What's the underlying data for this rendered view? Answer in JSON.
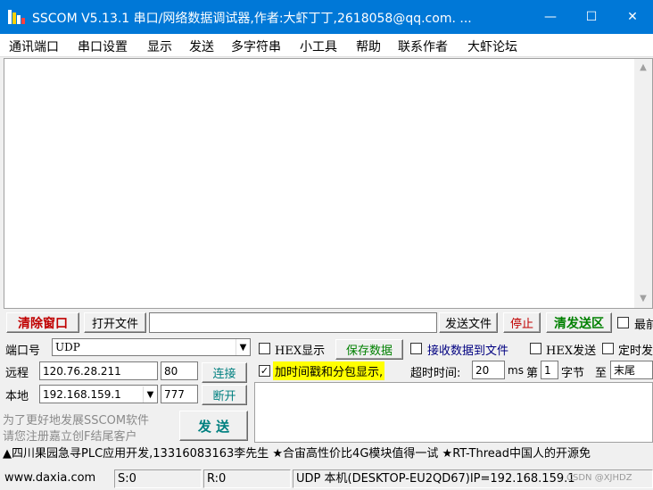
{
  "window": {
    "title": "SSCOM V5.13.1 串口/网络数据调试器,作者:大虾丁丁,2618058@qq.com. ...",
    "minimize": "—",
    "maximize": "☐",
    "close": "✕"
  },
  "menu": [
    "通讯端口",
    "串口设置",
    "显示",
    "发送",
    "多字符串",
    "小工具",
    "帮助",
    "联系作者",
    "大虾论坛"
  ],
  "toolbar": {
    "clear_window": "清除窗口",
    "open_file": "打开文件",
    "file_path": "",
    "send_file": "发送文件",
    "stop": "停止",
    "clear_send": "清发送区",
    "last_label": "最前"
  },
  "port": {
    "label": "端口号",
    "value": "UDP",
    "remote_label": "远程",
    "remote_ip": "120.76.28.211",
    "remote_port": "80",
    "connect": "连接",
    "local_label": "本地",
    "local_ip": "192.168.159.1",
    "local_port": "777",
    "disconnect": "断开"
  },
  "options": {
    "hex_display": "HEX显示",
    "save_data": "保存数据",
    "recv_to_file": "接收数据到文件",
    "hex_send": "HEX发送",
    "timed_send": "定时发",
    "timestamp": "加时间戳和分包显示,",
    "timestamp_checked": "✓",
    "timeout_label": "超时时间:",
    "timeout_value": "20",
    "ms": "ms",
    "di": "第",
    "byte_index": "1",
    "byte_label": "字节",
    "to_label": "至",
    "end_value": "末尾"
  },
  "promo": {
    "line1": "为了更好地发展SSCOM软件",
    "line2": "请您注册嘉立创F结尾客户"
  },
  "send_button": "发 送",
  "ticker": "▲四川果园急寻PLC应用开发,13316083163李先生 ★合宙高性价比4G模块值得一试 ★RT-Thread中国人的开源免",
  "status": {
    "site": "www.daxia.com",
    "s": "S:0",
    "r": "R:0",
    "info": "UDP 本机(DESKTOP-EU2QD67)IP=192.168.159.1",
    "watermark": "CSDN @XJHDZ"
  },
  "colors": {
    "title_bg": "#0078d7",
    "clear_red": "#c00000",
    "connect_green": "#008000",
    "highlight_yellow": "#ffff00"
  }
}
